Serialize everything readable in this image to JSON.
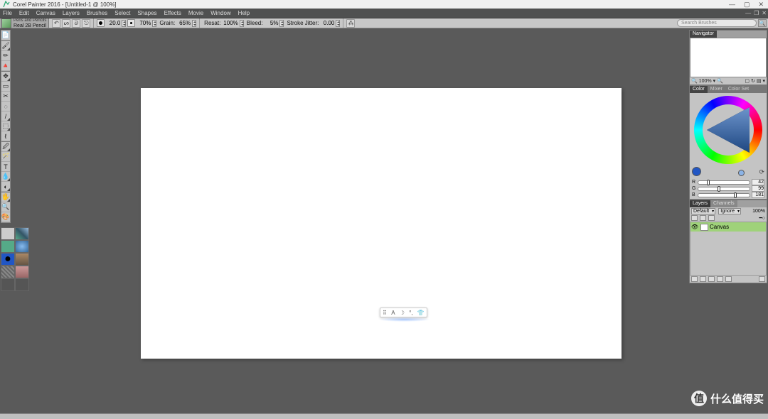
{
  "title": "Corel Painter 2016 - [Untitled-1 @ 100%]",
  "menubar": [
    "File",
    "Edit",
    "Canvas",
    "Layers",
    "Brushes",
    "Select",
    "Shapes",
    "Effects",
    "Movie",
    "Window",
    "Help"
  ],
  "brush": {
    "category": "Pens and Pencils",
    "variant": "Real 2B Pencil"
  },
  "propbar": {
    "size": "20.0",
    "opacity": "70%",
    "grain_lbl": "Grain:",
    "grain": "65%",
    "resat_lbl": "Resat:",
    "resat": "100%",
    "bleed_lbl": "Bleed:",
    "bleed": "5%",
    "jitter_lbl": "Stroke Jitter:",
    "jitter": "0.00"
  },
  "search_placeholder": "Search Brushes",
  "tools": [
    "📄",
    "🖌",
    "✏",
    "🔺",
    "✥",
    "▭",
    "✂",
    "◌",
    "/",
    "⬚",
    "ℓ",
    "🖉",
    "🪄",
    "T",
    "💧",
    "◐",
    "🖐",
    "🔍",
    "🎨"
  ],
  "navigator": {
    "title": "Navigator",
    "zoom": "100%"
  },
  "color": {
    "tabs": [
      "Color",
      "Mixer",
      "Color Set Libra..."
    ],
    "r": {
      "lab": "R",
      "val": "42",
      "pos": 16
    },
    "g": {
      "lab": "G",
      "val": "99",
      "pos": 38
    },
    "b": {
      "lab": "B",
      "val": "181",
      "pos": 70
    }
  },
  "layers": {
    "tabs": [
      "Layers",
      "Channels"
    ],
    "blend": "Default",
    "ignore": "Ignore",
    "opacity": "100%",
    "rows": [
      {
        "name": "Canvas",
        "sel": true
      }
    ]
  },
  "watermark": "什么值得买",
  "watermark_badge": "值"
}
